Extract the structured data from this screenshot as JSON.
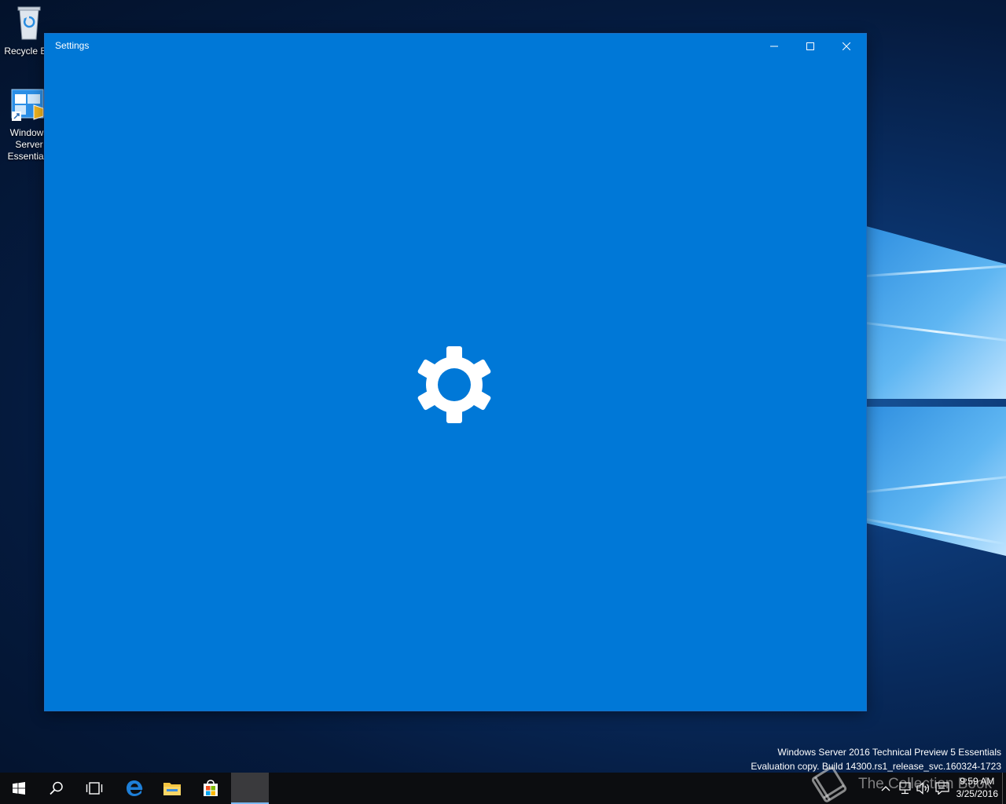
{
  "desktop": {
    "icons": [
      {
        "label": "Recycle Bin",
        "icon": "recycle-bin-icon"
      },
      {
        "label": "Windows Server Essentials",
        "icon": "server-dashboard-icon"
      }
    ],
    "watermark_line1": "Windows Server 2016 Technical Preview 5 Essentials",
    "watermark_line2": "Evaluation copy. Build 14300.rs1_release_svc.160324-1723"
  },
  "window": {
    "title": "Settings",
    "background": "#0078d7",
    "splash_icon": "gear-icon",
    "caption_buttons": [
      {
        "name": "minimize",
        "icon": "minimize-icon"
      },
      {
        "name": "maximize",
        "icon": "maximize-icon"
      },
      {
        "name": "close",
        "icon": "close-icon"
      }
    ]
  },
  "taskbar": {
    "buttons": [
      {
        "name": "start",
        "icon": "windows-start-icon"
      },
      {
        "name": "search",
        "icon": "search-icon"
      },
      {
        "name": "task-view",
        "icon": "task-view-icon"
      },
      {
        "name": "edge",
        "icon": "edge-icon"
      },
      {
        "name": "file-explorer",
        "icon": "folder-icon"
      },
      {
        "name": "store",
        "icon": "store-icon"
      },
      {
        "name": "settings",
        "icon": "settings-app-icon",
        "active": true
      }
    ],
    "tray": {
      "icons": [
        "chevron-up-icon",
        "network-icon",
        "volume-icon",
        "action-center-icon"
      ],
      "time": "9:59 AM",
      "date": "3/25/2016"
    },
    "overlay_watermark": "The Collection Book"
  }
}
